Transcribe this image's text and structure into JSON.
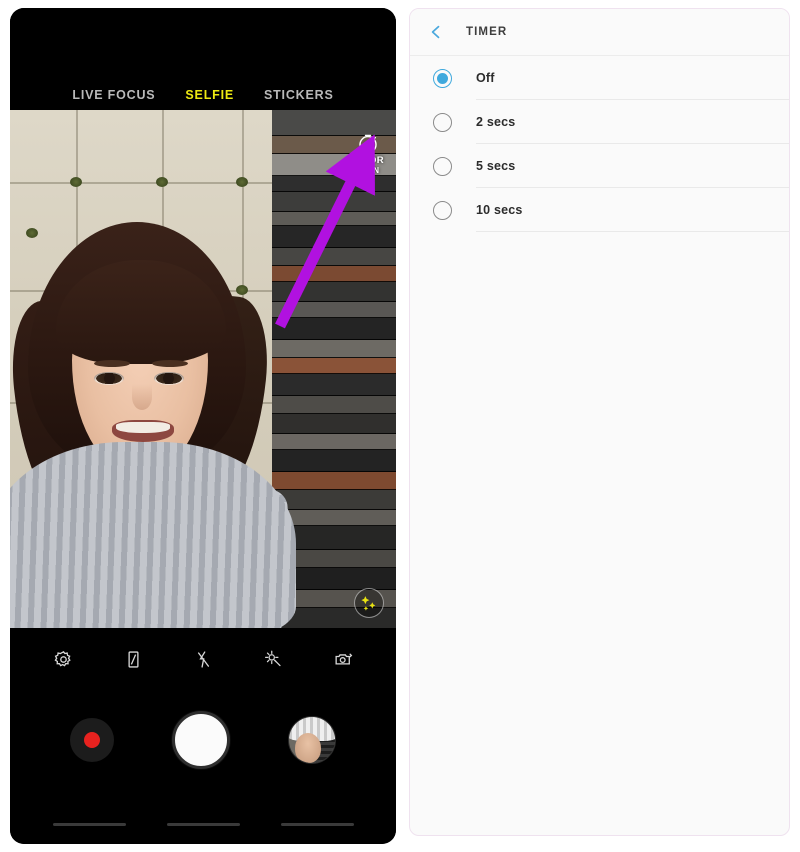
{
  "camera": {
    "modes": [
      {
        "label": "LIVE FOCUS",
        "active": false
      },
      {
        "label": "SELFIE",
        "active": true
      },
      {
        "label": "STICKERS",
        "active": false
      }
    ],
    "active_mode_color": "#edea12",
    "overlay": {
      "timer_icon": "timer-icon",
      "hdr_label": "HDR",
      "hdr_state": "ON",
      "beauty_icon": "beauty-sparkle-icon"
    },
    "annotation": {
      "arrow_icon": "pointer-arrow-icon",
      "color": "#b111e0",
      "points_to": "timer-icon"
    },
    "toolbar": [
      {
        "name": "settings-icon",
        "label": "Settings"
      },
      {
        "name": "aspect-ratio-icon",
        "label": "Aspect ratio"
      },
      {
        "name": "flash-off-icon",
        "label": "Flash off"
      },
      {
        "name": "beauty-effect-icon",
        "label": "Beauty effect"
      },
      {
        "name": "switch-camera-icon",
        "label": "Switch camera"
      }
    ],
    "shutter": {
      "record_label": "Record",
      "capture_label": "Capture",
      "gallery_label": "Gallery"
    },
    "navbar": [
      {
        "name": "nav-recents"
      },
      {
        "name": "nav-home"
      },
      {
        "name": "nav-back"
      }
    ]
  },
  "settings": {
    "back_icon": "chevron-left-icon",
    "title": "TIMER",
    "accent_color": "#3fa9dd",
    "options": [
      {
        "label": "Off",
        "selected": true
      },
      {
        "label": "2 secs",
        "selected": false
      },
      {
        "label": "5 secs",
        "selected": false
      },
      {
        "label": "10 secs",
        "selected": false
      }
    ]
  }
}
